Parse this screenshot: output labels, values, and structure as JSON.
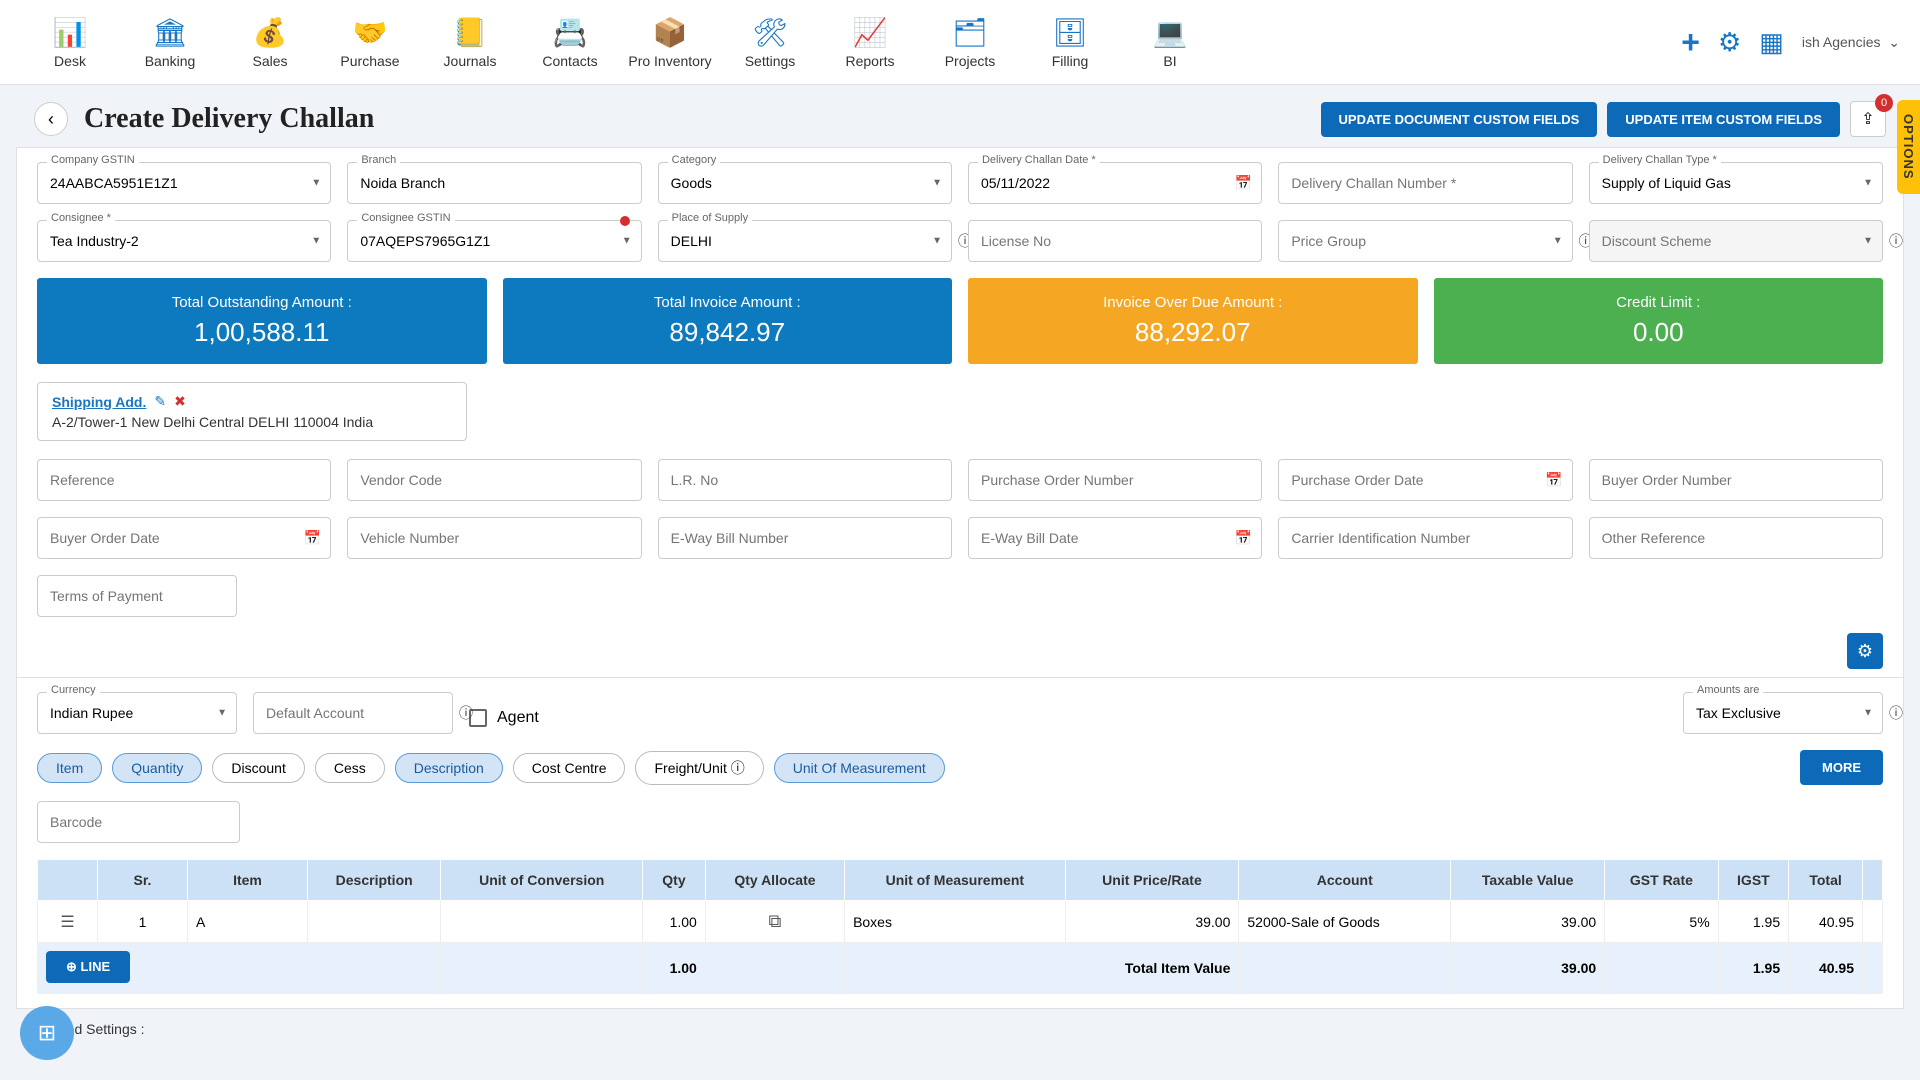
{
  "nav": {
    "items": [
      {
        "label": "Desk"
      },
      {
        "label": "Banking"
      },
      {
        "label": "Sales"
      },
      {
        "label": "Purchase"
      },
      {
        "label": "Journals"
      },
      {
        "label": "Contacts"
      },
      {
        "label": "Pro Inventory"
      },
      {
        "label": "Settings"
      },
      {
        "label": "Reports"
      },
      {
        "label": "Projects"
      },
      {
        "label": "Filling"
      },
      {
        "label": "BI"
      }
    ],
    "agency": "ish Agencies"
  },
  "page": {
    "title": "Create Delivery Challan"
  },
  "header_actions": {
    "update_doc": "UPDATE DOCUMENT CUSTOM FIELDS",
    "update_item": "UPDATE ITEM CUSTOM FIELDS",
    "badge": "0"
  },
  "options_tab": "OPTIONS",
  "fields": {
    "company_gstin": {
      "label": "Company GSTIN",
      "value": "24AABCA5951E1Z1"
    },
    "branch": {
      "label": "Branch",
      "value": "Noida Branch"
    },
    "category": {
      "label": "Category",
      "value": "Goods"
    },
    "challan_date": {
      "label": "Delivery Challan Date *",
      "value": "05/11/2022"
    },
    "challan_number": {
      "label": "",
      "placeholder": "Delivery Challan Number *"
    },
    "challan_type": {
      "label": "Delivery Challan Type *",
      "value": "Supply of Liquid Gas"
    },
    "consignee": {
      "label": "Consignee *",
      "value": "Tea Industry-2"
    },
    "consignee_gstin": {
      "label": "Consignee GSTIN",
      "value": "07AQEPS7965G1Z1"
    },
    "place_supply": {
      "label": "Place of Supply",
      "value": "DELHI"
    },
    "license_no": {
      "placeholder": "License No"
    },
    "price_group": {
      "placeholder": "Price Group"
    },
    "discount_scheme": {
      "placeholder": "Discount Scheme"
    },
    "reference": {
      "placeholder": "Reference"
    },
    "vendor_code": {
      "placeholder": "Vendor Code"
    },
    "lr_no": {
      "placeholder": "L.R. No"
    },
    "po_number": {
      "placeholder": "Purchase Order Number"
    },
    "po_date": {
      "placeholder": "Purchase Order Date"
    },
    "buyer_order_no": {
      "placeholder": "Buyer Order Number"
    },
    "buyer_order_date": {
      "placeholder": "Buyer Order Date"
    },
    "vehicle_no": {
      "placeholder": "Vehicle Number"
    },
    "eway_no": {
      "placeholder": "E-Way Bill Number"
    },
    "eway_date": {
      "placeholder": "E-Way Bill Date"
    },
    "carrier_id": {
      "placeholder": "Carrier Identification Number"
    },
    "other_ref": {
      "placeholder": "Other Reference"
    },
    "terms": {
      "placeholder": "Terms of Payment"
    },
    "currency": {
      "label": "Currency",
      "value": "Indian Rupee"
    },
    "default_acc": {
      "placeholder": "Default Account"
    },
    "agent_label": "Agent",
    "amounts_are": {
      "label": "Amounts are",
      "value": "Tax Exclusive"
    },
    "barcode": {
      "placeholder": "Barcode"
    }
  },
  "tiles": {
    "outstanding": {
      "label": "Total Outstanding Amount :",
      "value": "1,00,588.11"
    },
    "invoice": {
      "label": "Total Invoice Amount :",
      "value": "89,842.97"
    },
    "overdue": {
      "label": "Invoice Over Due Amount :",
      "value": "88,292.07"
    },
    "credit": {
      "label": "Credit Limit :",
      "value": "0.00"
    }
  },
  "shipping": {
    "title": "Shipping Add.",
    "address": "A-2/Tower-1 New Delhi Central DELHI 110004 India"
  },
  "pills": {
    "item": "Item",
    "quantity": "Quantity",
    "discount": "Discount",
    "cess": "Cess",
    "description": "Description",
    "cost_centre": "Cost Centre",
    "freight": "Freight/Unit",
    "uom": "Unit Of Measurement",
    "more": "MORE"
  },
  "table": {
    "headers": {
      "sr": "Sr.",
      "item": "Item",
      "desc": "Description",
      "uoc": "Unit of Conversion",
      "qty": "Qty",
      "qty_alloc": "Qty Allocate",
      "uom": "Unit of Measurement",
      "rate": "Unit Price/Rate",
      "account": "Account",
      "taxable": "Taxable Value",
      "gst_rate": "GST Rate",
      "igst": "IGST",
      "total": "Total"
    },
    "row": {
      "sr": "1",
      "item": "A",
      "desc": "",
      "uoc": "",
      "qty": "1.00",
      "uom": "Boxes",
      "rate": "39.00",
      "account": "52000-Sale of Goods",
      "taxable": "39.00",
      "gst_rate": "5%",
      "igst": "1.95",
      "total": "40.95"
    },
    "totals": {
      "label": "Total Item Value",
      "qty": "1.00",
      "taxable": "39.00",
      "igst": "1.95",
      "total": "40.95"
    },
    "line_btn": "LINE"
  },
  "advanced": "Advanced Settings :"
}
